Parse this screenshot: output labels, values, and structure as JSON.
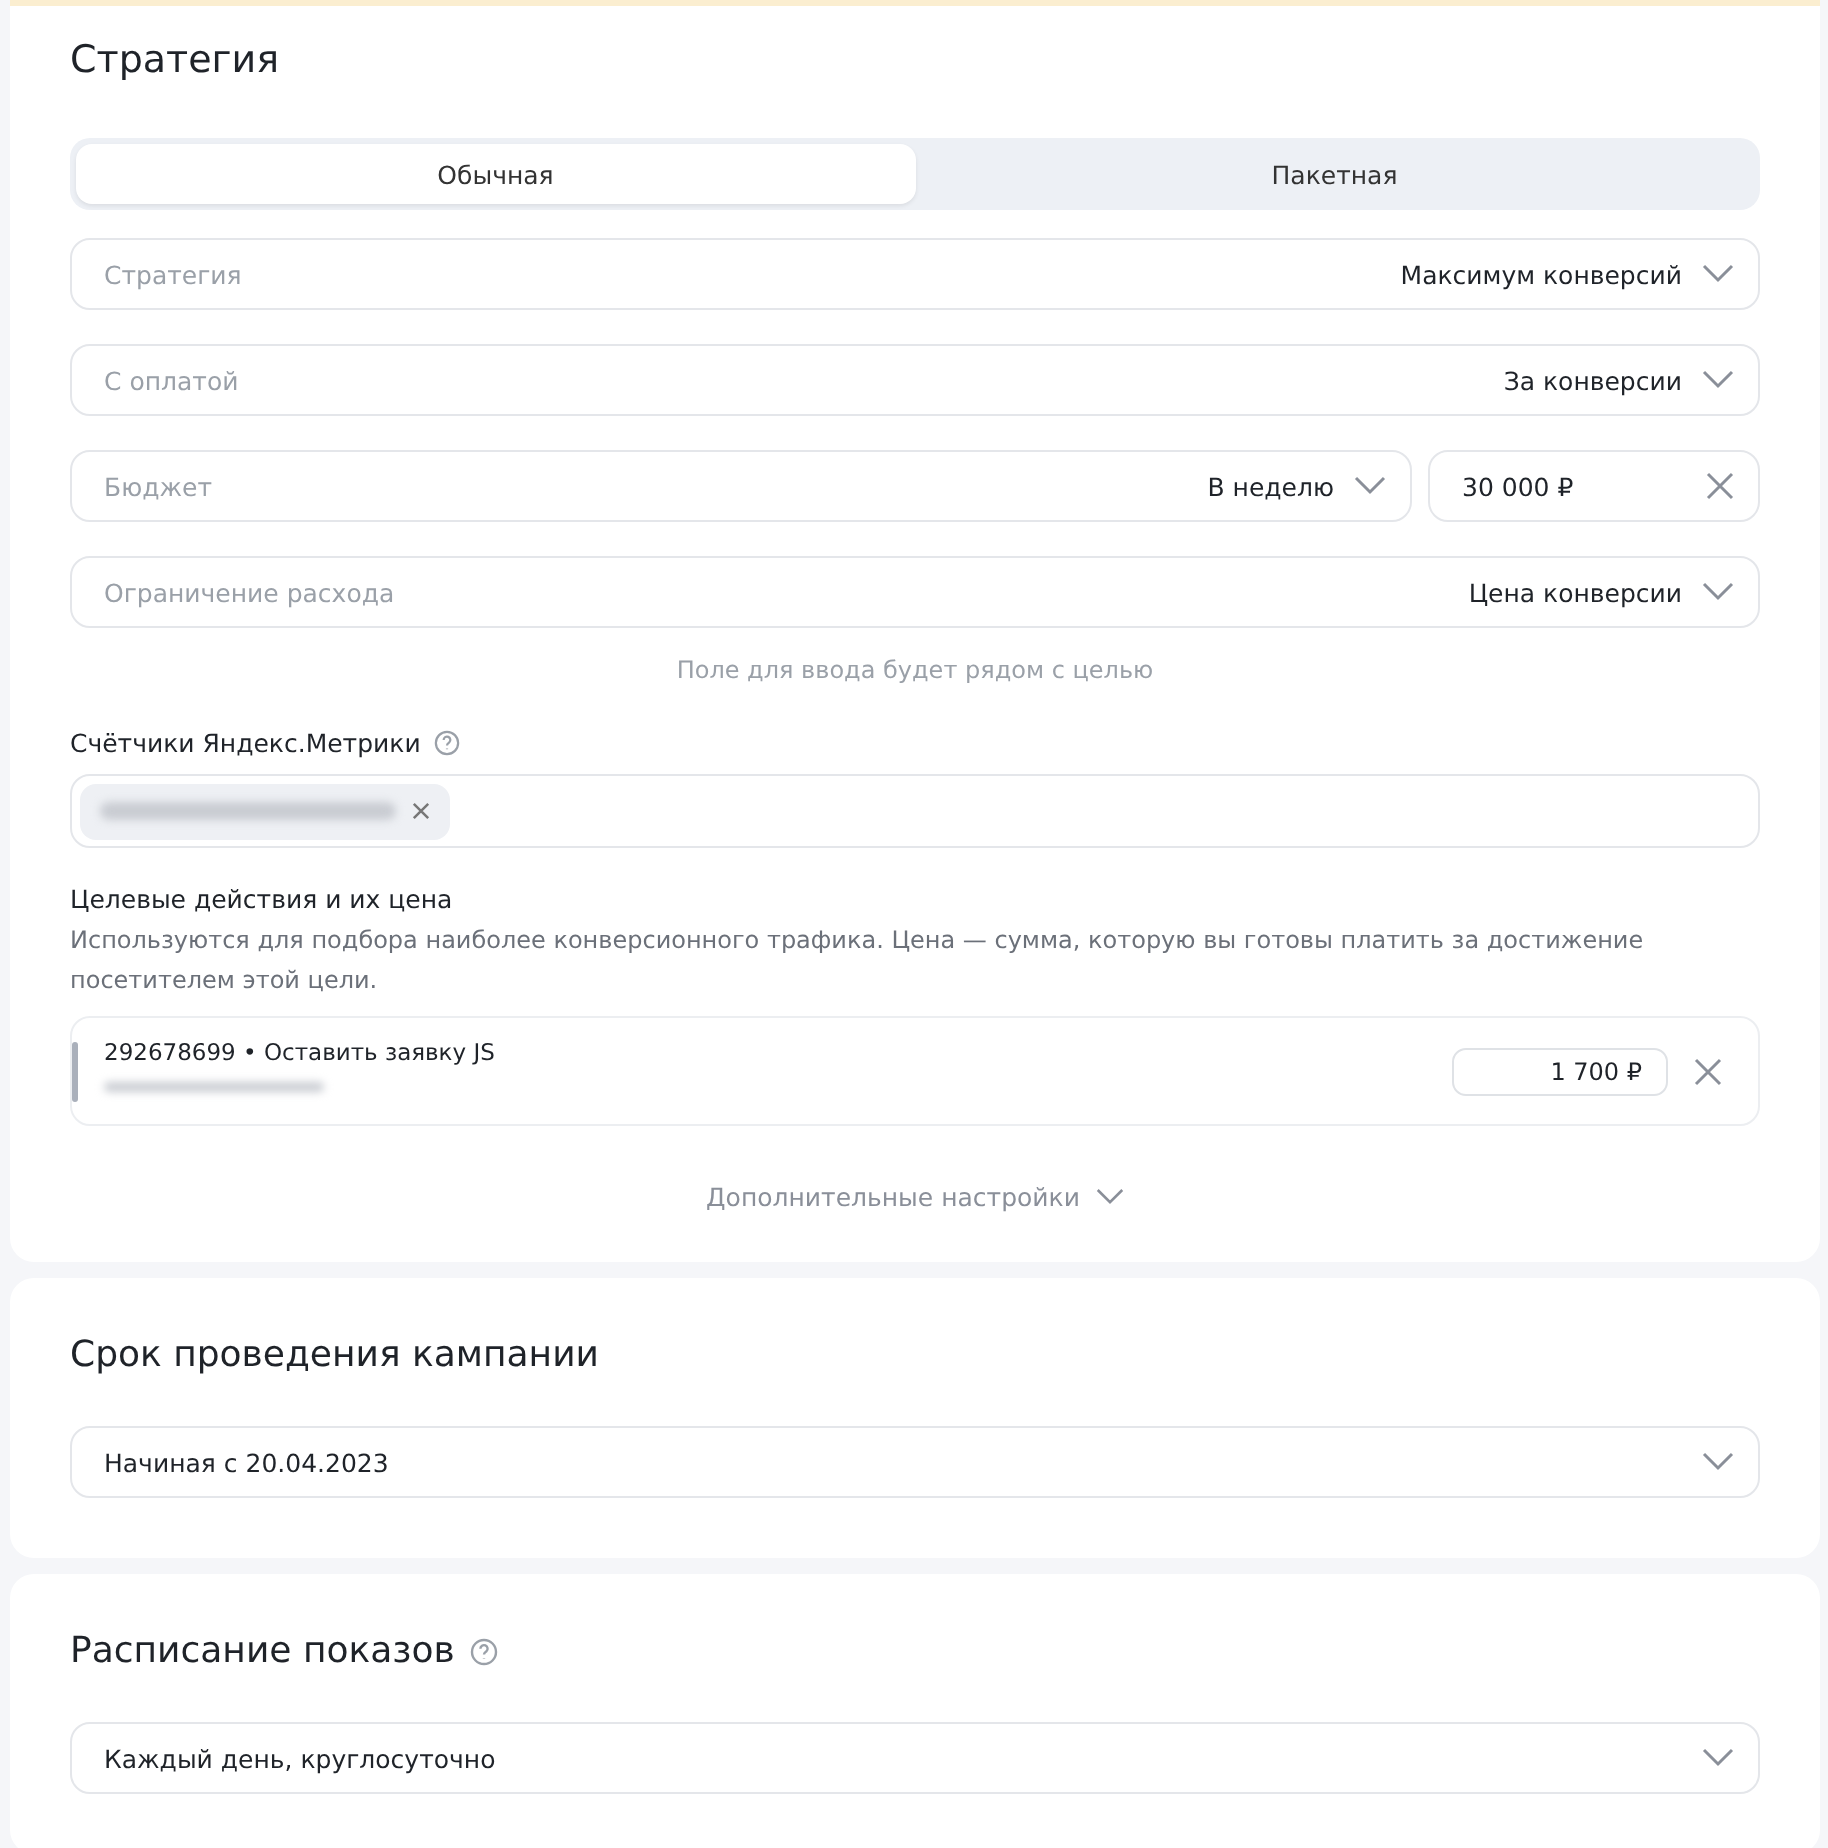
{
  "strategy": {
    "title": "Стратегия",
    "tabs": [
      {
        "label": "Обычная",
        "selected": true
      },
      {
        "label": "Пакетная",
        "selected": false
      }
    ],
    "fields": [
      {
        "kind": "select",
        "label": "Стратегия",
        "value": "Максимум конверсий"
      },
      {
        "kind": "select",
        "label": "С оплатой",
        "value": "За конверсии"
      },
      {
        "kind": "budget",
        "label": "Бюджет",
        "value": "В неделю",
        "amount": "30 000 ₽"
      },
      {
        "kind": "select",
        "label": "Ограничение расхода",
        "value": "Цена конверсии"
      }
    ],
    "hint": "Поле для ввода будет рядом с целью",
    "counters": {
      "label": "Счётчики Яндекс.Метрики",
      "chips": [
        {
          "redacted": true
        }
      ]
    },
    "goals": {
      "title": "Целевые действия и их цена",
      "description": "Используются для подбора наиболее конверсионного трафика. Цена — сумма, которую вы готовы платить за достижение посетителем этой цели.",
      "items": [
        {
          "name": "292678699 • Оставить заявку JS",
          "price": "1 700 ₽"
        }
      ]
    },
    "more": "Дополнительные настройки"
  },
  "period": {
    "title": "Срок проведения кампании",
    "value": "Начиная с 20.04.2023"
  },
  "schedule": {
    "title": "Расписание показов",
    "value": "Каждый день, круглосуточно"
  }
}
